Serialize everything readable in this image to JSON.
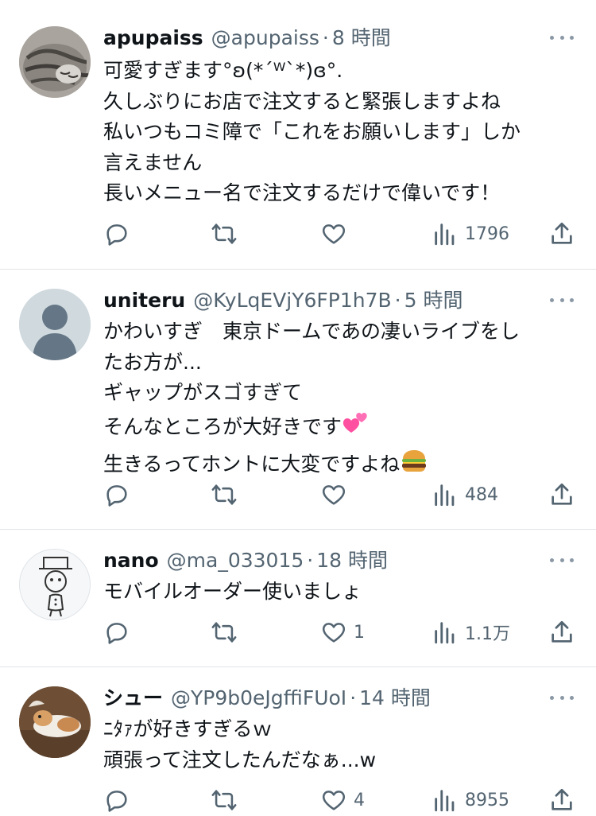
{
  "tweets": [
    {
      "name": "apupaiss",
      "handle": "@apupaiss",
      "time": "8 時間",
      "lines": [
        "可愛すぎます°ʚ(*´ᵂ`*)ɞ°.",
        "久しぶりにお店で注文すると緊張しますよね",
        "私いつもコミ障で「これをお願いします」しか",
        "言えません",
        "長いメニュー名で注文するだけで偉いです！"
      ],
      "replies": "",
      "retweets": "",
      "likes": "",
      "views": "1796",
      "avatar": "cat-photo"
    },
    {
      "name": "uniteru",
      "handle": "@KyLqEVjY6FP1h7B",
      "time": "5 時間",
      "lines": [
        "かわいすぎ　東京ドームであの凄いライブをし",
        "たお方が...",
        "ギャップがスゴすぎて",
        "そんなところが大好きです",
        "生きるってホントに大変ですよね"
      ],
      "emoji_after_line_4": "two-hearts-emoji",
      "emoji_after_line_5": "hamburger-emoji",
      "replies": "",
      "retweets": "",
      "likes": "",
      "views": "484",
      "avatar": "default-user"
    },
    {
      "name": "nano",
      "handle": "@ma_033015",
      "time": "18 時間",
      "lines": [
        "モバイルオーダー使いましょ"
      ],
      "replies": "",
      "retweets": "",
      "likes": "1",
      "views": "1.1万",
      "avatar": "doodle-character"
    },
    {
      "name": "シュー",
      "handle": "@YP9b0eJgffiFUoI",
      "time": "14 時間",
      "lines": [
        "ﾆﾀｧが好きすぎるｗ",
        "頑張って注文したんだなぁ...w"
      ],
      "replies": "",
      "retweets": "",
      "likes": "4",
      "views": "8955",
      "avatar": "dog-photo"
    }
  ],
  "colors": {
    "text": "#0f1419",
    "secondary": "#536471",
    "divider": "#e1e4e8",
    "icon": "#536471"
  }
}
